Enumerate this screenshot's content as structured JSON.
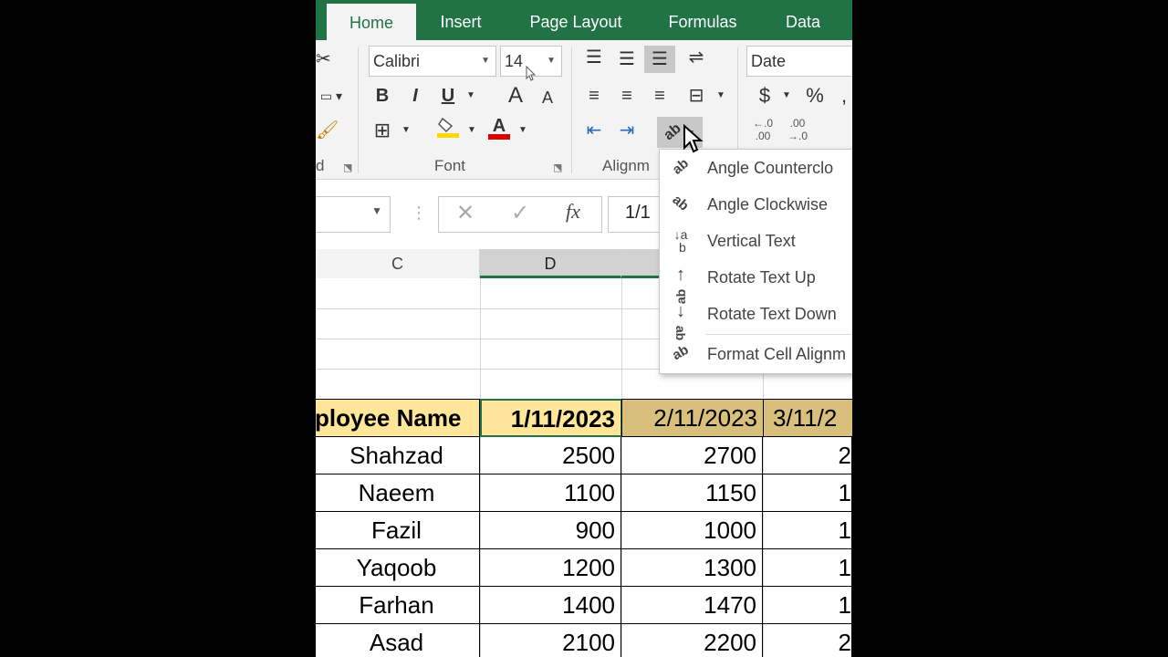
{
  "ribbon_tabs": [
    "Home",
    "Insert",
    "Page Layout",
    "Formulas",
    "Data"
  ],
  "font": {
    "name": "Calibri",
    "size": "14",
    "bold": "B",
    "italic": "I",
    "underline": "U",
    "grow": "A",
    "shrink": "A",
    "fill_icon": "fill-color-icon",
    "font_color_icon": "font-color-icon",
    "group_label": "Font"
  },
  "alignment": {
    "group_label": "Alignm"
  },
  "number": {
    "format": "Date",
    "currency": "$",
    "percent": "%"
  },
  "formula_bar": {
    "name_box": "",
    "cancel": "✕",
    "enter": "✓",
    "fx": "fx",
    "content": "1/1"
  },
  "columns": [
    "C",
    "D"
  ],
  "orientation_menu": {
    "items": [
      {
        "label": "Angle Counterclo",
        "icon": "angle-counterclockwise-icon"
      },
      {
        "label": "Angle Clockwise",
        "icon": "angle-clockwise-icon"
      },
      {
        "label": "Vertical Text",
        "icon": "vertical-text-icon"
      },
      {
        "label": "Rotate Text Up",
        "icon": "rotate-up-icon"
      },
      {
        "label": "Rotate Text Down",
        "icon": "rotate-down-icon"
      },
      {
        "label": "Format Cell Alignm",
        "icon": "format-alignment-icon"
      }
    ]
  },
  "sheet": {
    "header": [
      "ployee Name",
      "1/11/2023",
      "2/11/2023",
      "3/11/2"
    ],
    "rows": [
      [
        "Shahzad",
        "2500",
        "2700",
        "2"
      ],
      [
        "Naeem",
        "1100",
        "1150",
        "1"
      ],
      [
        "Fazil",
        "900",
        "1000",
        "1"
      ],
      [
        "Yaqoob",
        "1200",
        "1300",
        "1"
      ],
      [
        "Farhan",
        "1400",
        "1470",
        "1"
      ],
      [
        "Asad",
        "2100",
        "2200",
        "2"
      ]
    ]
  },
  "colors": {
    "accent": "#217346",
    "header_fill": "#ffe699",
    "selected_fill": "#d8bf7c",
    "font_red": "#e00000",
    "fill_yellow": "#ffd700"
  }
}
